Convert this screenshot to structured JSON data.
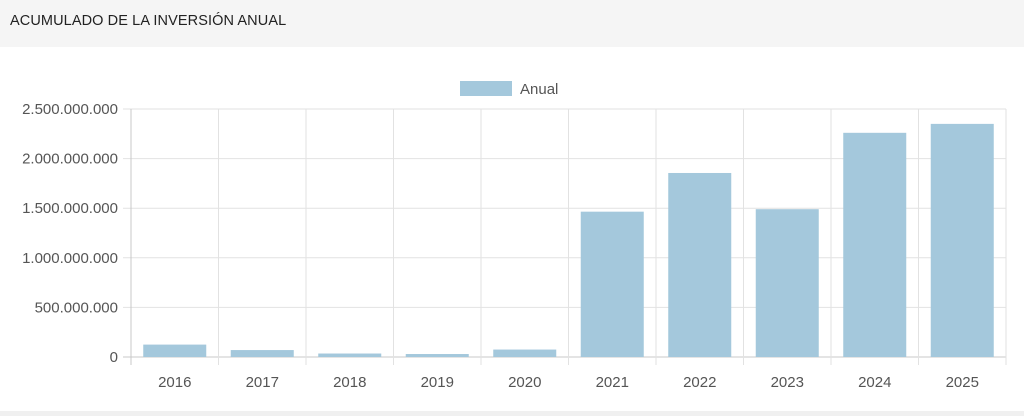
{
  "panel": {
    "title": "ACUMULADO DE LA INVERSIÓN ANUAL"
  },
  "colors": {
    "bar": "#a4c8dc",
    "grid": "#e2e2e2",
    "axis": "#c8c8c8",
    "text": "#555555"
  },
  "chart_data": {
    "type": "bar",
    "title": "",
    "xlabel": "",
    "ylabel": "",
    "categories": [
      "2016",
      "2017",
      "2018",
      "2019",
      "2020",
      "2021",
      "2022",
      "2023",
      "2024",
      "2025"
    ],
    "series": [
      {
        "name": "Anual",
        "values": [
          125000000,
          70000000,
          35000000,
          30000000,
          75000000,
          1465000000,
          1855000000,
          1490000000,
          2260000000,
          2350000000
        ]
      }
    ],
    "ylim": [
      0,
      2500000000
    ],
    "yticks": [
      "0",
      "500.000.000",
      "1.000.000.000",
      "1.500.000.000",
      "2.000.000.000",
      "2.500.000.000"
    ],
    "grid": true,
    "legend": "top-center"
  }
}
